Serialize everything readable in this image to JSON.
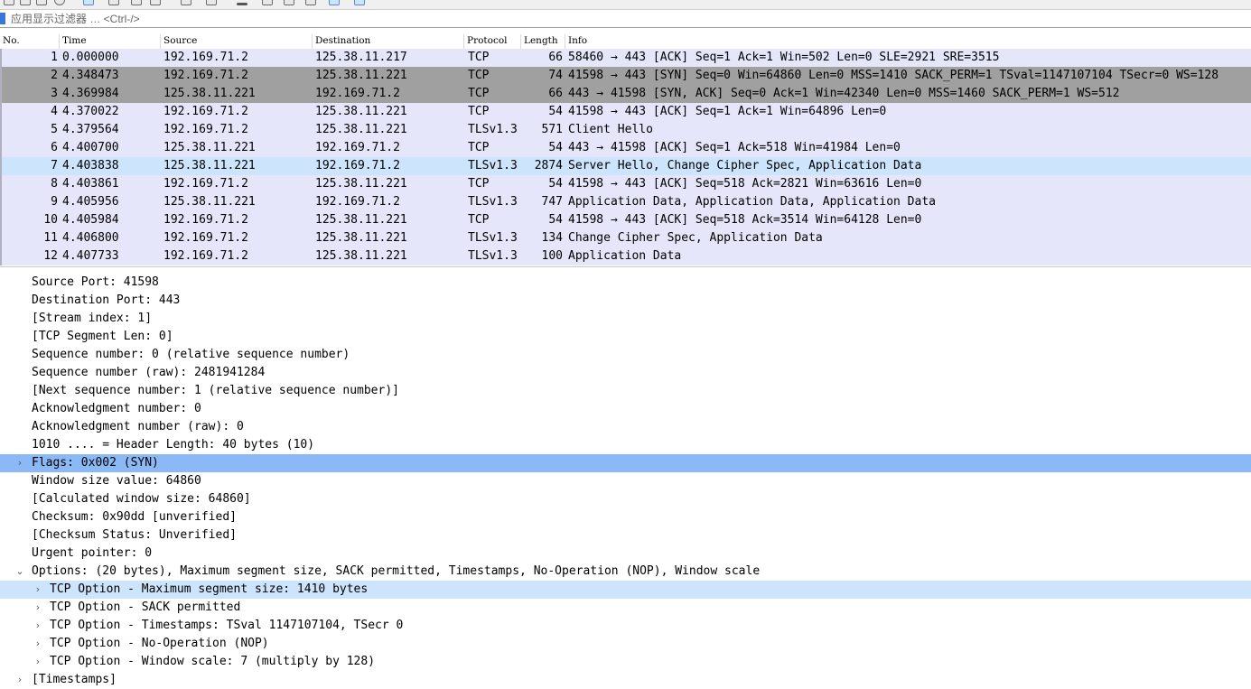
{
  "toolbar": {
    "icons": [
      "open-file-icon",
      "save-file-icon",
      "close-file-icon",
      "reload-icon",
      "find-packet-icon",
      "go-back-icon",
      "go-forward-icon",
      "go-to-packet-icon",
      "first-packet-icon",
      "last-packet-icon",
      "autoscroll-icon",
      "colorize-icon",
      "zoom-in-icon",
      "zoom-out-icon",
      "zoom-normal-icon",
      "resize-columns-icon"
    ]
  },
  "filter": {
    "placeholder": "应用显示过滤器 … <Ctrl-/>",
    "value": ""
  },
  "columns": [
    "No.",
    "Time",
    "Source",
    "Destination",
    "Protocol",
    "Length",
    "Info"
  ],
  "packets": [
    {
      "no": "1",
      "time": "0.000000",
      "src": "192.169.71.2",
      "dst": "125.38.11.217",
      "proto": "TCP",
      "len": "66",
      "info": "58460 → 443 [ACK] Seq=1 Ack=1 Win=502 Len=0 SLE=2921 SRE=3515",
      "style": "plain"
    },
    {
      "no": "2",
      "time": "4.348473",
      "src": "192.169.71.2",
      "dst": "125.38.11.221",
      "proto": "TCP",
      "len": "74",
      "info": "41598 → 443 [SYN] Seq=0 Win=64860 Len=0 MSS=1410 SACK_PERM=1 TSval=1147107104 TSecr=0 WS=128",
      "style": "gray"
    },
    {
      "no": "3",
      "time": "4.369984",
      "src": "125.38.11.221",
      "dst": "192.169.71.2",
      "proto": "TCP",
      "len": "66",
      "info": "443 → 41598 [SYN, ACK] Seq=0 Ack=1 Win=42340 Len=0 MSS=1460 SACK_PERM=1 WS=512",
      "style": "gray"
    },
    {
      "no": "4",
      "time": "4.370022",
      "src": "192.169.71.2",
      "dst": "125.38.11.221",
      "proto": "TCP",
      "len": "54",
      "info": "41598 → 443 [ACK] Seq=1 Ack=1 Win=64896 Len=0",
      "style": "plain"
    },
    {
      "no": "5",
      "time": "4.379564",
      "src": "192.169.71.2",
      "dst": "125.38.11.221",
      "proto": "TLSv1.3",
      "len": "571",
      "info": "Client Hello",
      "style": "plain"
    },
    {
      "no": "6",
      "time": "4.400700",
      "src": "125.38.11.221",
      "dst": "192.169.71.2",
      "proto": "TCP",
      "len": "54",
      "info": "443 → 41598 [ACK] Seq=1 Ack=518 Win=41984 Len=0",
      "style": "plain"
    },
    {
      "no": "7",
      "time": "4.403838",
      "src": "125.38.11.221",
      "dst": "192.169.71.2",
      "proto": "TLSv1.3",
      "len": "2874",
      "info": "Server Hello, Change Cipher Spec, Application Data",
      "style": "sel"
    },
    {
      "no": "8",
      "time": "4.403861",
      "src": "192.169.71.2",
      "dst": "125.38.11.221",
      "proto": "TCP",
      "len": "54",
      "info": "41598 → 443 [ACK] Seq=518 Ack=2821 Win=63616 Len=0",
      "style": "plain"
    },
    {
      "no": "9",
      "time": "4.405956",
      "src": "125.38.11.221",
      "dst": "192.169.71.2",
      "proto": "TLSv1.3",
      "len": "747",
      "info": "Application Data, Application Data, Application Data",
      "style": "plain"
    },
    {
      "no": "10",
      "time": "4.405984",
      "src": "192.169.71.2",
      "dst": "125.38.11.221",
      "proto": "TCP",
      "len": "54",
      "info": "41598 → 443 [ACK] Seq=518 Ack=3514 Win=64128 Len=0",
      "style": "plain"
    },
    {
      "no": "11",
      "time": "4.406800",
      "src": "192.169.71.2",
      "dst": "125.38.11.221",
      "proto": "TLSv1.3",
      "len": "134",
      "info": "Change Cipher Spec, Application Data",
      "style": "plain"
    },
    {
      "no": "12",
      "time": "4.407733",
      "src": "192.169.71.2",
      "dst": "125.38.11.221",
      "proto": "TLSv1.3",
      "len": "100",
      "info": "Application Data",
      "style": "plain"
    }
  ],
  "details": [
    {
      "level": 1,
      "text": "Source Port: 41598",
      "toggle": "none",
      "style": ""
    },
    {
      "level": 1,
      "text": "Destination Port: 443",
      "toggle": "none",
      "style": ""
    },
    {
      "level": 1,
      "text": "[Stream index: 1]",
      "toggle": "none",
      "style": ""
    },
    {
      "level": 1,
      "text": "[TCP Segment Len: 0]",
      "toggle": "none",
      "style": ""
    },
    {
      "level": 1,
      "text": "Sequence number: 0    (relative sequence number)",
      "toggle": "none",
      "style": ""
    },
    {
      "level": 1,
      "text": "Sequence number (raw): 2481941284",
      "toggle": "none",
      "style": ""
    },
    {
      "level": 1,
      "text": "[Next sequence number: 1    (relative sequence number)]",
      "toggle": "none",
      "style": ""
    },
    {
      "level": 1,
      "text": "Acknowledgment number: 0",
      "toggle": "none",
      "style": ""
    },
    {
      "level": 1,
      "text": "Acknowledgment number (raw): 0",
      "toggle": "none",
      "style": ""
    },
    {
      "level": 1,
      "text": "1010 .... = Header Length: 40 bytes (10)",
      "toggle": "none",
      "style": ""
    },
    {
      "level": 1,
      "text": "Flags: 0x002 (SYN)",
      "toggle": "collapsed",
      "style": "sel"
    },
    {
      "level": 1,
      "text": "Window size value: 64860",
      "toggle": "none",
      "style": ""
    },
    {
      "level": 1,
      "text": "[Calculated window size: 64860]",
      "toggle": "none",
      "style": ""
    },
    {
      "level": 1,
      "text": "Checksum: 0x90dd [unverified]",
      "toggle": "none",
      "style": ""
    },
    {
      "level": 1,
      "text": "[Checksum Status: Unverified]",
      "toggle": "none",
      "style": ""
    },
    {
      "level": 1,
      "text": "Urgent pointer: 0",
      "toggle": "none",
      "style": ""
    },
    {
      "level": 1,
      "text": "Options: (20 bytes), Maximum segment size, SACK permitted, Timestamps, No-Operation (NOP), Window scale",
      "toggle": "expanded",
      "style": ""
    },
    {
      "level": 2,
      "text": "TCP Option - Maximum segment size: 1410 bytes",
      "toggle": "collapsed",
      "style": "hi"
    },
    {
      "level": 2,
      "text": "TCP Option - SACK permitted",
      "toggle": "collapsed",
      "style": ""
    },
    {
      "level": 2,
      "text": "TCP Option - Timestamps: TSval 1147107104, TSecr 0",
      "toggle": "collapsed",
      "style": ""
    },
    {
      "level": 2,
      "text": "TCP Option - No-Operation (NOP)",
      "toggle": "collapsed",
      "style": ""
    },
    {
      "level": 2,
      "text": "TCP Option - Window scale: 7 (multiply by 128)",
      "toggle": "collapsed",
      "style": ""
    },
    {
      "level": 1,
      "text": "[Timestamps]",
      "toggle": "collapsed",
      "style": ""
    }
  ],
  "colors": {
    "row_plain": "#e6e6fa",
    "row_gray": "#a0a0a0",
    "row_selected": "#cce4fc",
    "detail_selected": "#8ab9f5"
  }
}
